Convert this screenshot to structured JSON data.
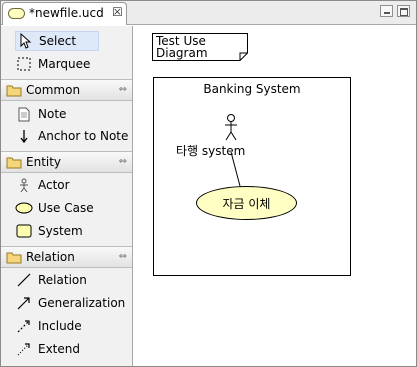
{
  "editor_tab": {
    "title": "*newfile.ucd",
    "close_glyph": "☒",
    "icon": "usecase-file-icon"
  },
  "window_buttons": {
    "minimize_icon": "minimize-icon",
    "maximize_icon": "maximize-icon"
  },
  "palette": {
    "tools": [
      {
        "label": "Select",
        "icon": "arrow-pointer-icon"
      },
      {
        "label": "Marquee",
        "icon": "marquee-icon"
      }
    ],
    "drawers": [
      {
        "label": "Common",
        "icon": "folder-icon",
        "items": [
          {
            "label": "Note",
            "icon": "note-icon"
          },
          {
            "label": "Anchor to Note",
            "icon": "anchor-arrow-icon"
          }
        ]
      },
      {
        "label": "Entity",
        "icon": "folder-icon",
        "items": [
          {
            "label": "Actor",
            "icon": "actor-icon"
          },
          {
            "label": "Use Case",
            "icon": "usecase-icon"
          },
          {
            "label": "System",
            "icon": "system-icon"
          }
        ]
      },
      {
        "label": "Relation",
        "icon": "folder-icon",
        "items": [
          {
            "label": "Relation",
            "icon": "line-icon"
          },
          {
            "label": "Generalization",
            "icon": "generalization-arrow-icon"
          },
          {
            "label": "Include",
            "icon": "include-arrow-icon"
          },
          {
            "label": "Extend",
            "icon": "extend-arrow-icon"
          }
        ]
      }
    ],
    "drawer_toggle_glyph": "⇔"
  },
  "diagram": {
    "note_text": "Test Use\nDiagram",
    "system_name": "Banking System",
    "actor_name": "타행 system",
    "usecase_name": "자금 이체"
  }
}
